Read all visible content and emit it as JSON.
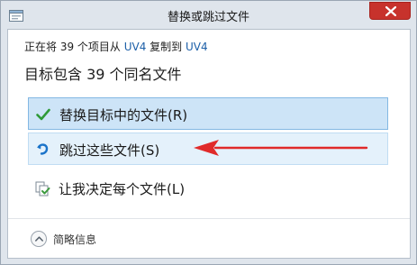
{
  "window": {
    "title": "替换或跳过文件"
  },
  "status": {
    "prefix": "正在将 39 个项目从 ",
    "source": "UV4",
    "middle": " 复制到 ",
    "destination": "UV4"
  },
  "headline": "目标包含 39 个同名文件",
  "options": [
    {
      "label": "替换目标中的文件(R)",
      "icon": "check-icon",
      "icon_color": "#2e9a37"
    },
    {
      "label": "跳过这些文件(S)",
      "icon": "skip-arrow-icon",
      "icon_color": "#1a73c9"
    },
    {
      "label": "让我决定每个文件(L)",
      "icon": "copy-files-icon",
      "icon_color": "#3b9a3c"
    }
  ],
  "details": {
    "label": "简略信息",
    "icon": "chevron-up-icon"
  },
  "annotation": {
    "icon": "red-arrow-icon",
    "color": "#e02a2a"
  },
  "colors": {
    "link": "#1c5fa8",
    "close_button": "#c7322c",
    "selected_option": "#cde4f7",
    "hover_option": "#e4f1fb"
  }
}
